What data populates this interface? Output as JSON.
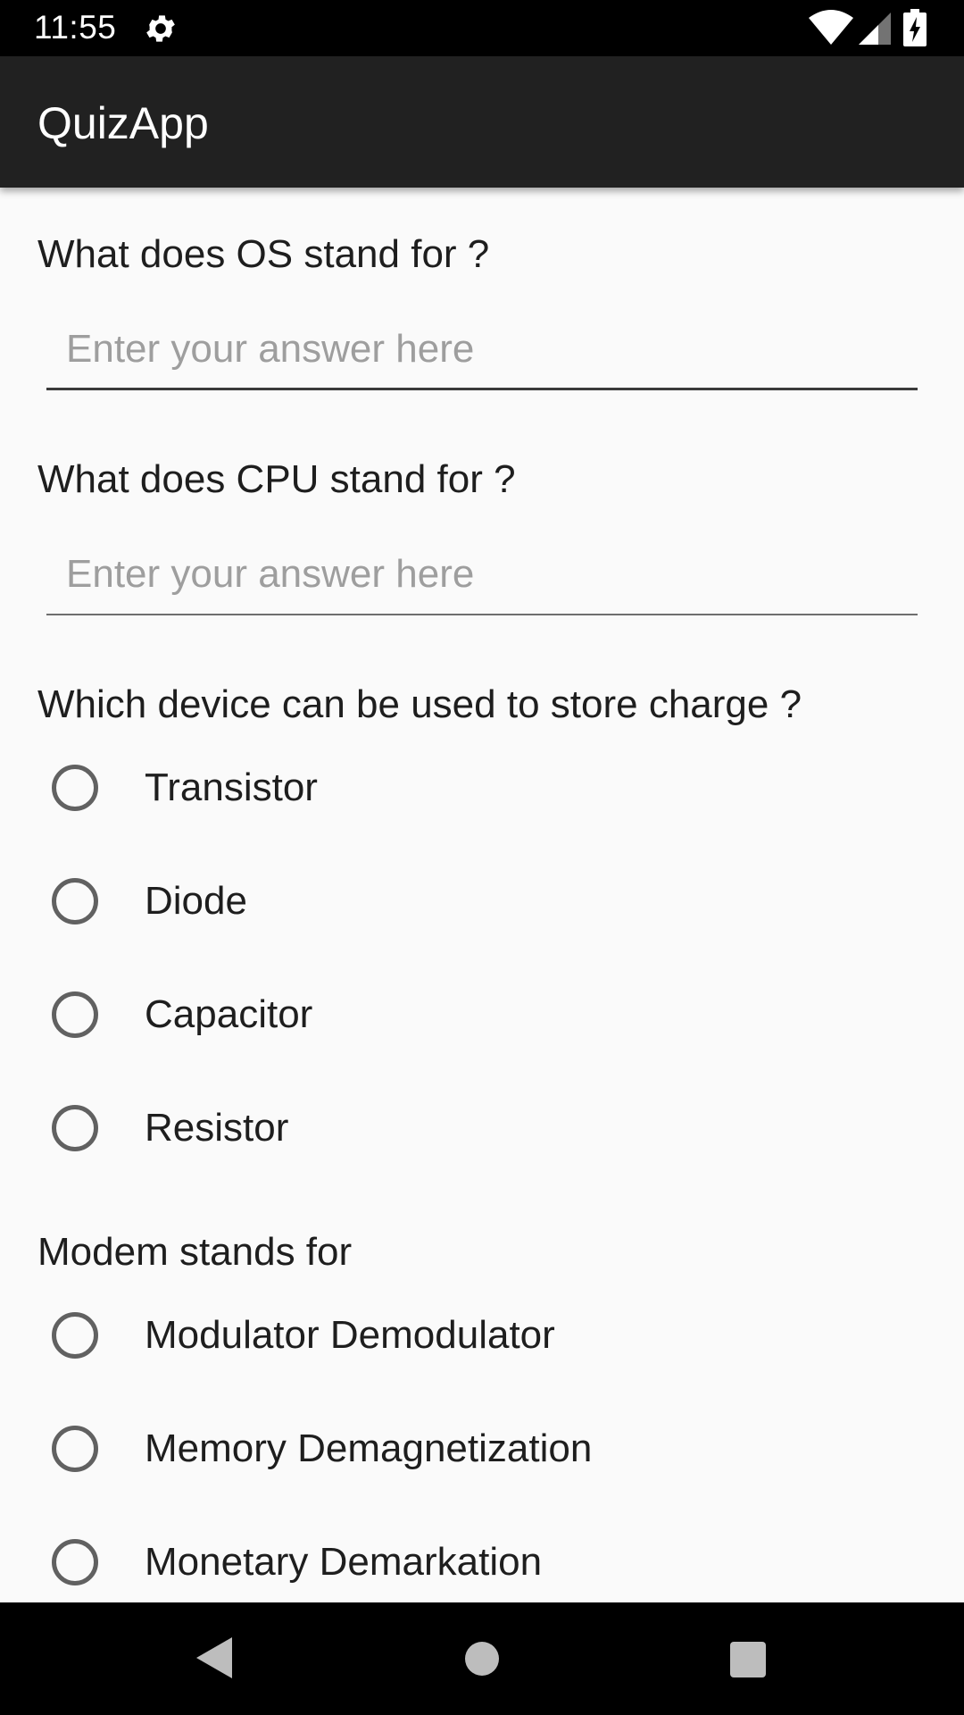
{
  "status_bar": {
    "time": "11:55",
    "icons": [
      "gear-icon",
      "wifi-icon",
      "signal-icon",
      "battery-charging-icon"
    ]
  },
  "app_bar": {
    "title": "QuizApp"
  },
  "questions": [
    {
      "text": "What does OS stand for ?",
      "placeholder": "Enter your answer here",
      "value": ""
    },
    {
      "text": "What does CPU stand for ?",
      "placeholder": "Enter your answer here",
      "value": ""
    },
    {
      "text": "Which device can be used to store charge ?",
      "options": [
        "Transistor",
        "Diode",
        "Capacitor",
        "Resistor"
      ]
    },
    {
      "text": "Modem stands for",
      "options": [
        "Modulator Demodulator",
        "Memory Demagnetization",
        "Monetary Demarkation"
      ]
    }
  ],
  "nav_bar": {
    "icons": [
      "back-icon",
      "home-icon",
      "recents-icon"
    ]
  },
  "colors": {
    "status_bar": "#000000",
    "app_bar": "#212121",
    "background": "#fafafa",
    "radio": "#616161",
    "placeholder": "#9e9e9e"
  }
}
